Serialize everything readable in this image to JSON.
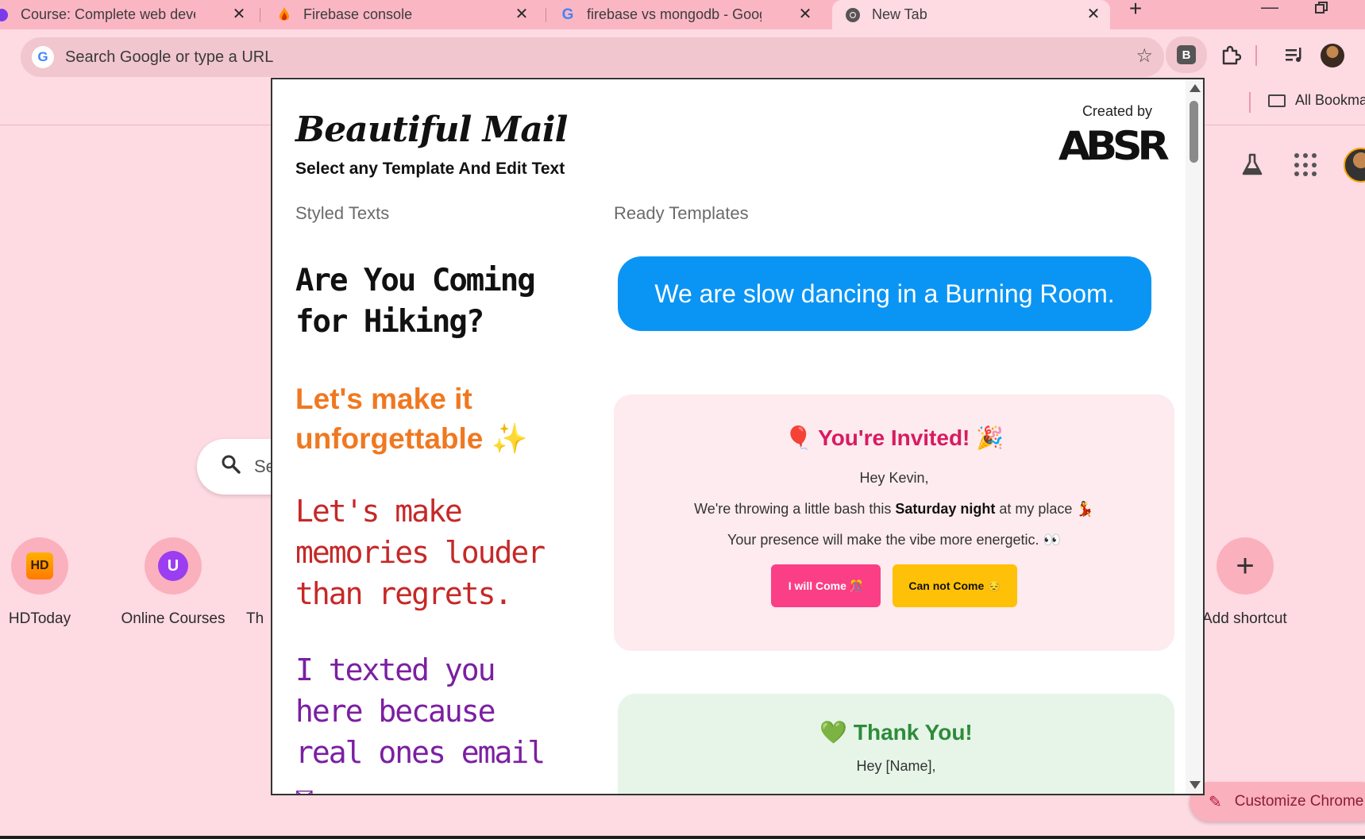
{
  "browser": {
    "tabs": [
      {
        "title": "Course: Complete web develop",
        "active": false
      },
      {
        "title": "Firebase console",
        "active": false
      },
      {
        "title": "firebase vs mongodb - Google",
        "active": false
      },
      {
        "title": "New Tab",
        "active": true
      }
    ],
    "omnibox_placeholder": "Search Google or type a URL",
    "extension_letter": "B",
    "bookmarks_all": "All Bookma"
  },
  "ntp": {
    "search_placeholder": "Se",
    "shortcuts": [
      {
        "label": "HDToday",
        "badge": "HD"
      },
      {
        "label": "Online Courses",
        "badge": "U"
      },
      {
        "label": "Th",
        "badge": ""
      },
      {
        "label": "Add shortcut",
        "badge": "+"
      }
    ],
    "customize_label": "Customize Chrome"
  },
  "popup": {
    "brand": "Beautiful Mail",
    "tagline": "Select any Template And Edit Text",
    "created_by": "Created by",
    "logo_text": "ABSR",
    "section_styled": "Styled Texts",
    "section_templates": "Ready Templates",
    "styled_texts": [
      "Are You Coming for Hiking?",
      "Let's make it unforgettable ✨",
      "Let's make memories louder than regrets.",
      "I texted you here because real ones email ✉"
    ],
    "bubble_text": "We are slow dancing in a Burning Room.",
    "invite": {
      "heading": "🎈 You're Invited! 🎉",
      "greeting": "Hey Kevin,",
      "line1_pre": "We're throwing a little bash this ",
      "line1_bold": "Saturday night",
      "line1_post": " at my place 💃",
      "line2": "Your presence will make the vibe more energetic. 👀",
      "btn_come": "I will Come 🎊",
      "btn_not": "Can not Come 😔"
    },
    "thanks": {
      "heading": "💚 Thank You!",
      "greeting": "Hey [Name],"
    }
  },
  "colors": {
    "page_bg": "#fedae2",
    "tabstrip_bg": "#fbb6c4",
    "bubble_blue": "#0a95f5",
    "invite_heading": "#d81b60",
    "btn_pink": "#fb3f86",
    "btn_yellow": "#ffc107",
    "thanks_green": "#2e8b3a",
    "styled_orange": "#f07820",
    "styled_red": "#c62828",
    "styled_purple": "#7b1fa2"
  }
}
